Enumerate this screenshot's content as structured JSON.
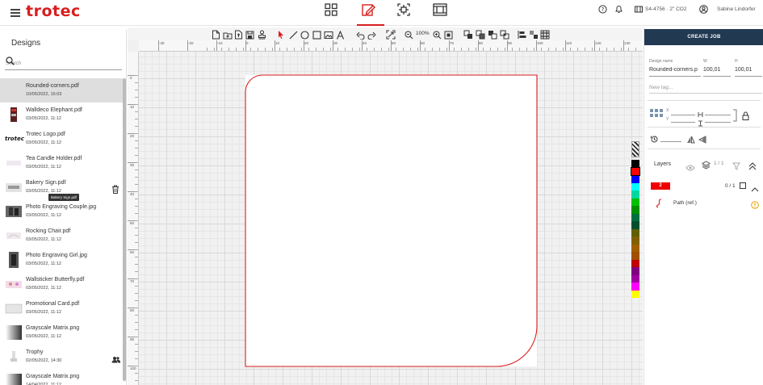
{
  "header": {
    "logo": "trotec",
    "device": "S4-4756 · 2\" CO2",
    "user": "Sabine Lindorfer"
  },
  "sidebar": {
    "title": "Designs",
    "search_placeholder": "Search",
    "tooltip": "Bakery Sign.pdf",
    "items": [
      {
        "name": "Rounded-corners.pdf",
        "date": "10/05/2022, 16:03",
        "thumb": "blank"
      },
      {
        "name": "Walldeco Elephant.pdf",
        "date": "03/05/2022, 11:12",
        "thumb": "elephant"
      },
      {
        "name": "Trotec Logo.pdf",
        "date": "03/05/2022, 11:12",
        "thumb": "logo"
      },
      {
        "name": "Tea Candle Holder.pdf",
        "date": "03/05/2022, 11:12",
        "thumb": "light"
      },
      {
        "name": "Bakery Sign.pdf",
        "date": "03/05/2022, 11:12",
        "thumb": "sign"
      },
      {
        "name": "Photo Engraving Couple.jpg",
        "date": "03/05/2022, 11:12",
        "thumb": "photo"
      },
      {
        "name": "Rocking Chair.pdf",
        "date": "03/05/2022, 11:12",
        "thumb": "chair"
      },
      {
        "name": "Photo Engraving Girl.jpg",
        "date": "03/05/2022, 11:12",
        "thumb": "photo2"
      },
      {
        "name": "Wallsticker Butterfly.pdf",
        "date": "03/05/2022, 11:12",
        "thumb": "butterfly"
      },
      {
        "name": "Promotional Card.pdf",
        "date": "03/05/2022, 11:12",
        "thumb": "card"
      },
      {
        "name": "Grayscale Matrix.png",
        "date": "03/05/2022, 11:12",
        "thumb": "gray"
      },
      {
        "name": "Trophy",
        "date": "02/05/2022, 14:30",
        "thumb": "trophy"
      },
      {
        "name": "Grayscale Matrix.png",
        "date": "14/04/2022, 11:12",
        "thumb": "gray"
      }
    ]
  },
  "toolbar": {
    "zoom": "100%"
  },
  "rulers": {
    "h": [
      "-50",
      "-40",
      "-30",
      "-20",
      "-10",
      "0",
      "10",
      "20",
      "30",
      "40",
      "50",
      "60",
      "70",
      "80",
      "90",
      "100",
      "110",
      "120",
      "130",
      "140",
      "150",
      "160",
      "170"
    ],
    "v": [
      "0",
      "10",
      "20",
      "30",
      "40",
      "50",
      "60",
      "70",
      "80",
      "90",
      "100"
    ]
  },
  "palette": [
    "#000000",
    "#ff0000",
    "#0000ff",
    "#00ffff",
    "#00d8a0",
    "#00c000",
    "#009000",
    "#007040",
    "#005030",
    "#606000",
    "#806000",
    "#a06000",
    "#a05000",
    "#c00000",
    "#800080",
    "#a000a0",
    "#ff00ff",
    "#ffff00"
  ],
  "palette_top": [
    "#ffffff",
    "#aaaaaa",
    "#555555"
  ],
  "right": {
    "create_job": "CREATE JOB",
    "design_name_label": "Design name",
    "design_name": "Rounded-corners.p",
    "w_label": "W",
    "w_value": "100,01",
    "h_label": "H",
    "h_value": "100,01",
    "tag_placeholder": "New tag...",
    "x_label": "X",
    "y_label": "Y",
    "layers_title": "Layers",
    "layers_count": "1 / 1",
    "layer_number": "2",
    "layer_count": "0 / 1",
    "path_label": "Path (ref.)"
  },
  "colors": {
    "brand": "#d81e1e",
    "create_job_bg": "#213a52",
    "shape_stroke": "#d81e1e"
  }
}
